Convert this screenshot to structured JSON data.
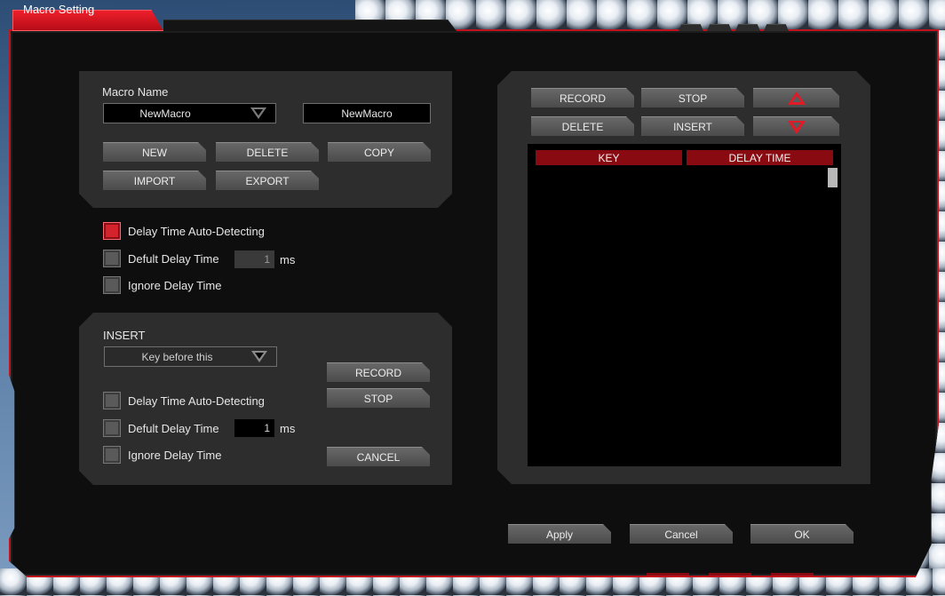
{
  "window": {
    "title": "Macro Setting"
  },
  "macro_panel": {
    "name_label": "Macro Name",
    "name_select": "NewMacro",
    "name_field": "NewMacro",
    "buttons": {
      "new": "NEW",
      "delete": "DELETE",
      "copy": "COPY",
      "import": "IMPORT",
      "export": "EXPORT"
    }
  },
  "delay_options": {
    "auto_detect": {
      "label": "Delay Time Auto-Detecting",
      "checked": true
    },
    "default_delay": {
      "label": "Defult Delay Time",
      "value": "1",
      "unit": "ms",
      "checked": false
    },
    "ignore": {
      "label": "Ignore Delay Time",
      "checked": false
    }
  },
  "insert_panel": {
    "title": "INSERT",
    "position_select": "Key before this",
    "auto_detect": {
      "label": "Delay Time Auto-Detecting",
      "checked": false
    },
    "default_delay": {
      "label": "Defult Delay Time",
      "value": "1",
      "unit": "ms",
      "checked": false
    },
    "ignore": {
      "label": "Ignore Delay Time",
      "checked": false
    },
    "buttons": {
      "record": "RECORD",
      "stop": "STOP",
      "cancel": "CANCEL"
    }
  },
  "record_panel": {
    "buttons": {
      "record": "RECORD",
      "stop": "STOP",
      "delete": "DELETE",
      "insert": "INSERT"
    },
    "icons": {
      "move_up": "triangle-up-icon",
      "move_down": "triangle-down-icon"
    },
    "table": {
      "columns": [
        "KEY",
        "DELAY TIME"
      ],
      "rows": []
    }
  },
  "footer": {
    "apply": "Apply",
    "cancel": "Cancel",
    "ok": "OK"
  },
  "colors": {
    "accent": "#d4232c",
    "header": "#8a0a12",
    "panel": "#2d2d2d",
    "window": "#0e0e0e"
  }
}
